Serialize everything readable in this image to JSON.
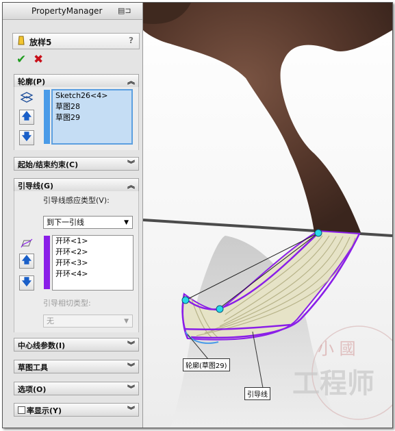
{
  "pm": {
    "title": "PropertyManager"
  },
  "feature": {
    "name": "放样5",
    "help": "?"
  },
  "actions": {
    "ok": "✔",
    "cancel": "✖"
  },
  "profiles": {
    "header": "轮廓(P)",
    "items": [
      "Sketch26<4>",
      "草图28",
      "草图29"
    ]
  },
  "start_end": {
    "header": "起始/结束约束(C)"
  },
  "guides": {
    "header": "引导线(G)",
    "influence_label": "引导线感应类型(V):",
    "influence_value": "到下一引线",
    "items": [
      "开环<1>",
      "开环<2>",
      "开环<3>",
      "开环<4>"
    ],
    "tangency_label": "引导相切类型:",
    "tangency_value": "无"
  },
  "centerline": {
    "header": "中心线参数(I)"
  },
  "sketch_tools": {
    "header": "草图工具"
  },
  "options": {
    "header": "选项(O)"
  },
  "curvature": {
    "header": "率显示(Y)"
  },
  "viewport": {
    "callout_profile": "轮廓(草图29)",
    "callout_guide": "引导线",
    "watermark_top": "小 國",
    "watermark_main": "工程师"
  },
  "colors": {
    "profile_bar": "#4a9be8",
    "guide_bar": "#8a1ee8",
    "surface_brown": "#5a3a2b",
    "guide_curve": "#8a1ee8"
  },
  "icons": {
    "feature": "loft-icon",
    "pin": "pin-icon",
    "up": "arrow-up-icon",
    "down": "arrow-down-icon"
  }
}
